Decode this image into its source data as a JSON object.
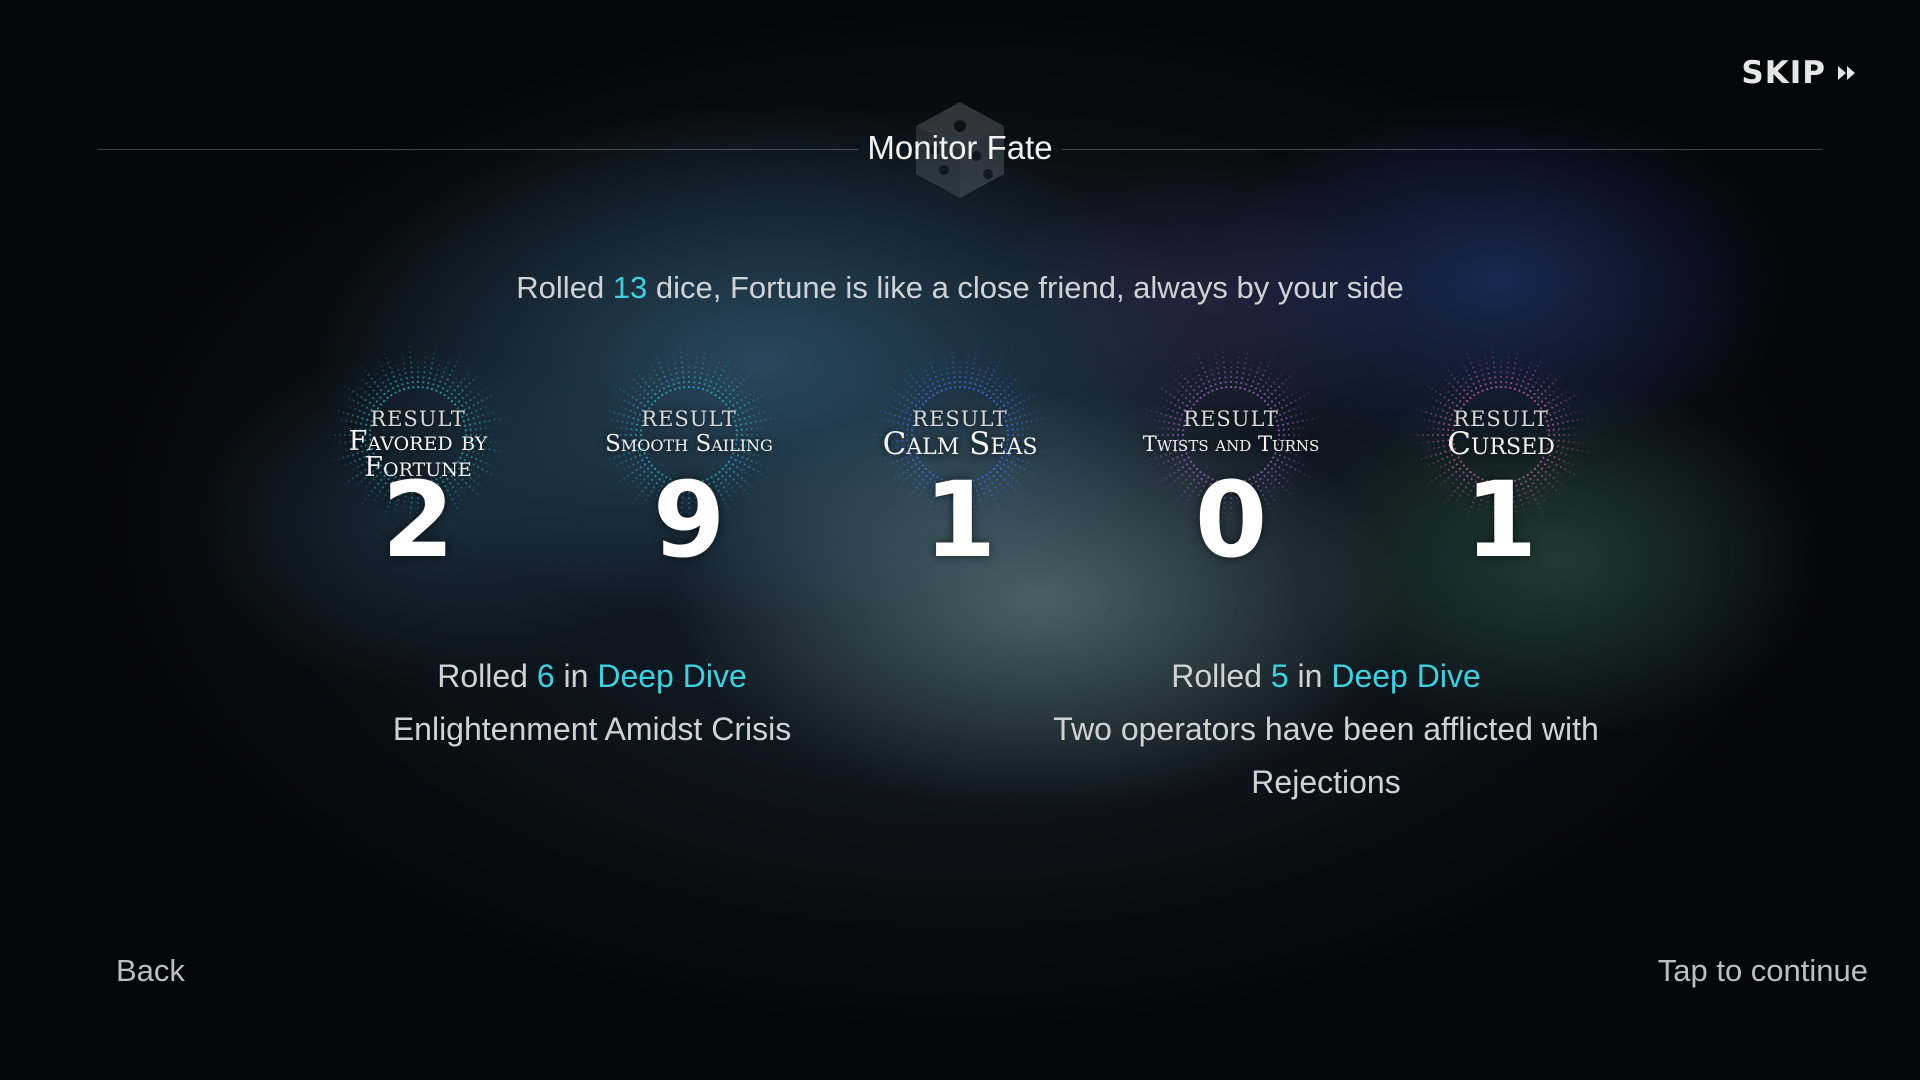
{
  "header": {
    "title": "Monitor Fate",
    "skip_label": "SKIP",
    "skip_icon": "fast-forward-icon",
    "emblem_icon": "dice-icon"
  },
  "summary": {
    "prefix": "Rolled ",
    "dice_count": "13",
    "suffix": " dice, Fortune is like a close friend, always by your side"
  },
  "results": [
    {
      "tag": "RESULT",
      "name_line1": "Favored by",
      "name_line2": "Fortune",
      "count": "2",
      "ray_color": "#2aa7c0"
    },
    {
      "tag": "RESULT",
      "name_line1": "Smooth Sailing",
      "name_line2": "",
      "count": "9",
      "ray_color": "#2aa7c0"
    },
    {
      "tag": "RESULT",
      "name_line1": "Calm Seas",
      "name_line2": "",
      "count": "1",
      "ray_color": "#3b6fe0"
    },
    {
      "tag": "RESULT",
      "name_line1": "Twists and Turns",
      "name_line2": "",
      "count": "0",
      "ray_color": "#9a5fc0"
    },
    {
      "tag": "RESULT",
      "name_line1": "Cursed",
      "name_line2": "",
      "count": "1",
      "ray_color": "#c05aa0"
    }
  ],
  "events": [
    {
      "prefix": "Rolled ",
      "roll": "6",
      "middle": " in ",
      "location": "Deep Dive",
      "line2": "Enlightenment Amidst Crisis",
      "line3": ""
    },
    {
      "prefix": "Rolled ",
      "roll": "5",
      "middle": " in ",
      "location": "Deep Dive",
      "line2": "Two operators have been afflicted with",
      "line3": "Rejections"
    }
  ],
  "footer": {
    "back_label": "Back",
    "continue_label": "Tap to continue"
  },
  "colors": {
    "highlight": "#3fd0e0"
  }
}
